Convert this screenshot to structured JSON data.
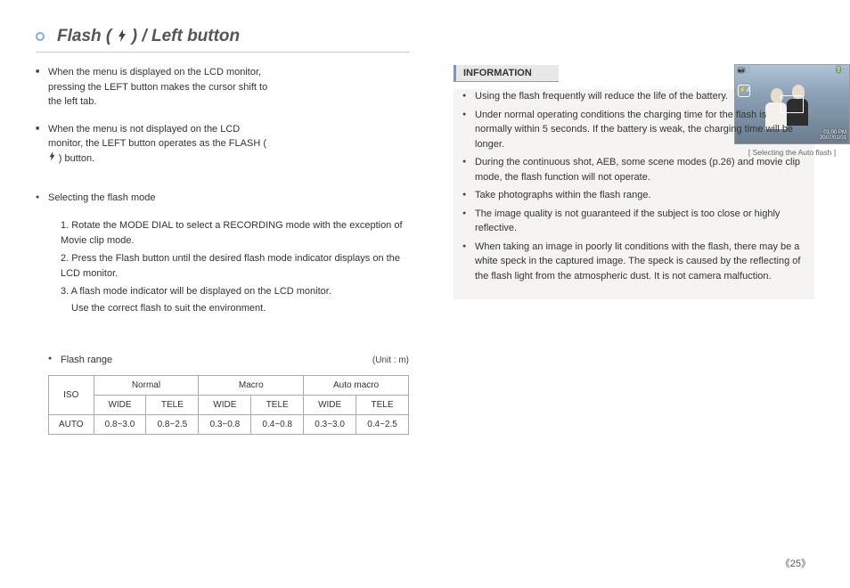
{
  "title": {
    "prefix": "Flash (",
    "suffix": ") / Left button"
  },
  "left": {
    "p1": "When the menu is displayed on the LCD monitor, pressing the LEFT button makes the cursor shift to the left tab.",
    "p2_a": "When the menu is not displayed on the LCD monitor, the LEFT button operates as the FLASH (",
    "p2_b": ") button.",
    "photo": {
      "overlay_top_left": "5",
      "overlay_top_right": "7",
      "overlay_flash": "⚡A",
      "overlay_time": "01:00 PM",
      "overlay_date": "2007/01/01",
      "caption": "[ Selecting the Auto flash ]"
    },
    "selecting_heading": "Selecting the flash mode",
    "steps": {
      "s1": "1. Rotate the MODE DIAL to select a RECORDING mode with the exception of Movie clip mode.",
      "s2": "2. Press the Flash button until the desired flash mode indicator displays on the LCD monitor.",
      "s3a": "3. A flash mode indicator will be displayed on the LCD monitor.",
      "s3b": "Use the correct flash to suit the environment."
    },
    "flash_range_label": "Flash range",
    "unit_label": "(Unit : m)",
    "table": {
      "iso": "ISO",
      "normal": "Normal",
      "macro": "Macro",
      "auto_macro": "Auto macro",
      "wide": "WIDE",
      "tele": "TELE",
      "row_label": "AUTO",
      "v1": "0.8~3.0",
      "v2": "0.8~2.5",
      "v3": "0.3~0.8",
      "v4": "0.4~0.8",
      "v5": "0.3~3.0",
      "v6": "0.4~2.5"
    }
  },
  "right": {
    "info_heading": "INFORMATION",
    "items": {
      "i1": "Using the flash frequently will reduce the life of the battery.",
      "i2": "Under normal operating conditions the charging time for the flash is normally within 5 seconds. If the battery is weak, the charging time will be longer.",
      "i3": "During the continuous shot, AEB, some scene modes (p.26) and movie clip mode, the flash function will not operate.",
      "i4": "Take photographs within the flash range.",
      "i5": "The image quality is not guaranteed if the subject is too close or highly reflective.",
      "i6": "When taking an image in poorly lit conditions with the flash, there may be a white speck in the captured image. The speck is caused by the reflecting of the flash light from the atmospheric dust. It is not camera malfuction."
    }
  },
  "page_number": "《25》"
}
